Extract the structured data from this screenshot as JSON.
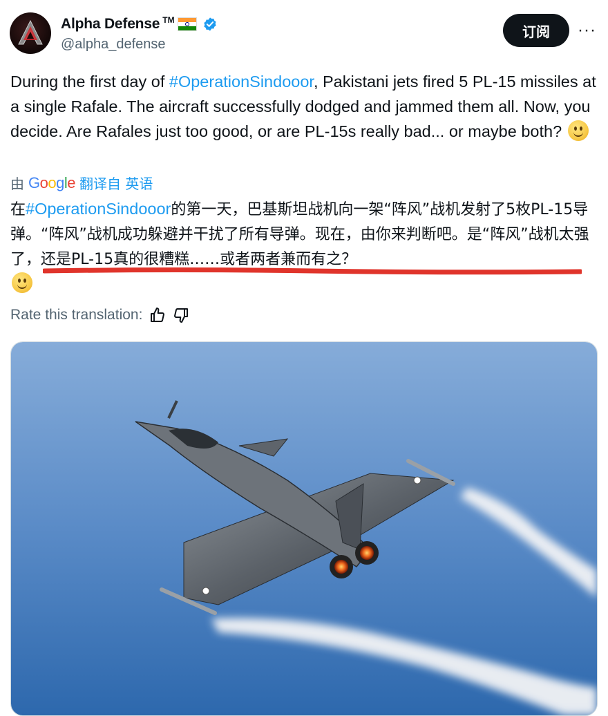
{
  "account": {
    "display_name": "Alpha Defense",
    "trademark": "TM",
    "flag_icon": "india-flag-icon",
    "verified_icon": "verified-badge-icon",
    "handle": "@alpha_defense",
    "avatar_icon": "alpha-logo-avatar"
  },
  "actions": {
    "subscribe_label": "订阅",
    "more_label": "···"
  },
  "post": {
    "text_before": "During the first day of ",
    "hashtag": "#OperationSindooor",
    "text_after": ", Pakistani jets fired 5 PL-15 missiles at a single Rafale. The aircraft successfully dodged and jammed them all. Now, you decide. Are Rafales just too good, or are PL-15s really bad... or maybe both?",
    "emoji": "slightly-smiling-face"
  },
  "translation": {
    "by_prefix": "由",
    "google_letters": [
      "G",
      "o",
      "o",
      "g",
      "l",
      "e"
    ],
    "translated_from": "翻译自 英语",
    "zh_before": "在",
    "zh_hashtag": "#OperationSindooor",
    "zh_after": "的第一天，巴基斯坦战机向一架“阵风”战机发射了5枚PL-15导弹。“阵风”战机成功躲避并干扰了所有导弹。现在，由你来判断吧。是“阵风”战机太强了，还是PL-15真的很糟糕……或者两者兼而有之？",
    "emoji": "slightly-smiling-face",
    "annotation_color": "#e0342b"
  },
  "rating": {
    "label": "Rate this translation:",
    "thumbs_up_icon": "thumbs-up-icon",
    "thumbs_down_icon": "thumbs-down-icon"
  },
  "media": {
    "description_icon": "rafale-jet-photo"
  },
  "colors": {
    "accent": "#1d9bf0",
    "text": "#0f1419",
    "secondary": "#536471",
    "sky_top": "#7fa8d8",
    "sky_bottom": "#2f6fb3"
  }
}
